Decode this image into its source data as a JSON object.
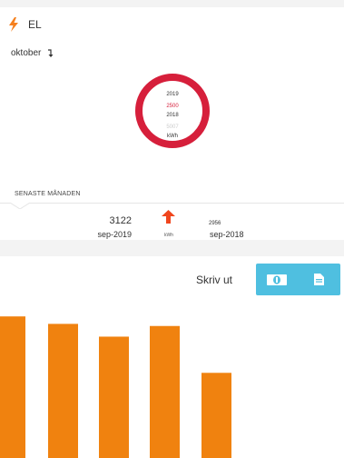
{
  "header": {
    "title": "EL",
    "icon": "lightning-bolt-icon",
    "accent": "#f5801e"
  },
  "period": {
    "month": "oktober",
    "icon": "arrow-down-icon"
  },
  "ring": {
    "year_current": "2019",
    "value_current": "2500",
    "year_previous": "2018",
    "value_previous": "5007",
    "unit": "kWh",
    "color": "#d61f3b"
  },
  "last_month": {
    "label": "SENASTE MÅNADEN",
    "current_value": "3122",
    "current_month": "sep-2019",
    "trend_icon": "arrow-up-icon",
    "trend_color": "#f0461e",
    "unit": "kWh",
    "previous_value": "2956",
    "previous_month": "sep-2018"
  },
  "toolbar": {
    "print_label": "Skriv ut",
    "money_icon": "money-icon",
    "document_icon": "document-icon",
    "button_color": "#4fbfe0"
  },
  "chart_data": {
    "type": "bar",
    "color": "#f0820f",
    "values": [
      133,
      126,
      114,
      124,
      80
    ],
    "ylim": [
      0,
      140
    ]
  }
}
